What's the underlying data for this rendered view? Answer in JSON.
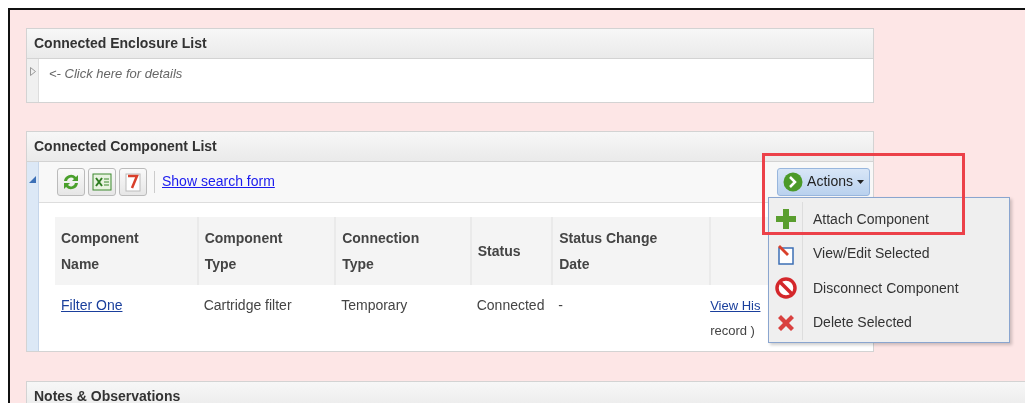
{
  "panels": [
    {
      "kind": "enclosure",
      "title": "Connected Enclosure List",
      "expanded": false,
      "hint": "<- Click here for details"
    },
    {
      "kind": "components",
      "title": "Connected Component List",
      "expanded": true,
      "toolbar": {
        "link": "Show search form",
        "actions_button": "Actions"
      },
      "table": {
        "columns": [
          "Component Name",
          "Component Type",
          "Connection Type",
          "Status",
          "Status Change Date"
        ],
        "rows": [
          {
            "cells": [
              {
                "kind": "link",
                "text": "Filter One"
              },
              {
                "kind": "text",
                "text": "Cartridge filter"
              },
              {
                "kind": "text",
                "text": "Temporary"
              },
              {
                "kind": "text",
                "text": "Connected"
              },
              {
                "kind": "text",
                "text": "-"
              },
              {
                "kind": "history",
                "link": "View His",
                "text": "record )"
              }
            ]
          }
        ]
      }
    },
    {
      "kind": "notes",
      "title": "Notes & Observations"
    }
  ],
  "actions_menu": {
    "open": true,
    "highlighted": true,
    "items": [
      {
        "kind": "attach",
        "label": "Attach Component"
      },
      {
        "kind": "edit",
        "label": "View/Edit Selected"
      },
      {
        "kind": "disconnect",
        "label": "Disconnect Component"
      },
      {
        "kind": "delete",
        "label": "Delete Selected"
      }
    ]
  }
}
